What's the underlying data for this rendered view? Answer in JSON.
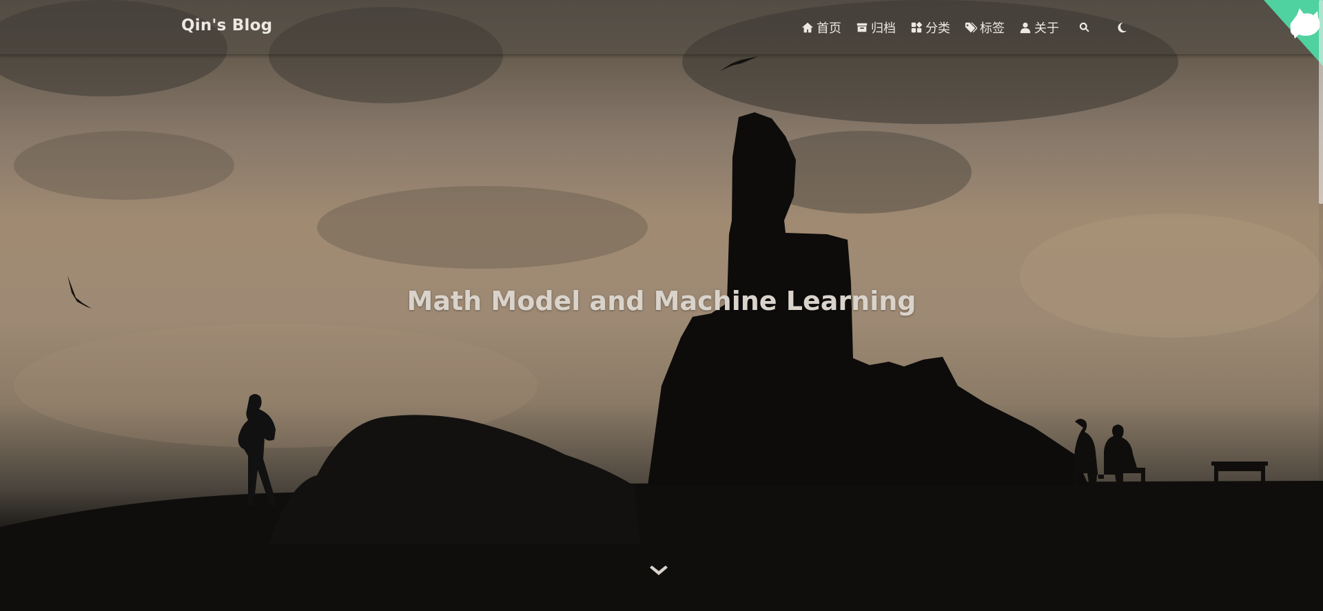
{
  "site": {
    "brand": "Qin's Blog"
  },
  "nav": {
    "items": [
      {
        "label": "首页",
        "icon": "home-icon"
      },
      {
        "label": "归档",
        "icon": "archive-icon"
      },
      {
        "label": "分类",
        "icon": "category-icon"
      },
      {
        "label": "标签",
        "icon": "tags-icon"
      },
      {
        "label": "关于",
        "icon": "user-icon"
      }
    ],
    "search_icon": "search-icon",
    "theme_icon": "moon-icon"
  },
  "hero": {
    "title": "Math Model and Machine Learning",
    "scroll_icon": "chevron-down-icon"
  },
  "corner": {
    "icon": "cat-icon",
    "color": "#4fd1a0"
  }
}
